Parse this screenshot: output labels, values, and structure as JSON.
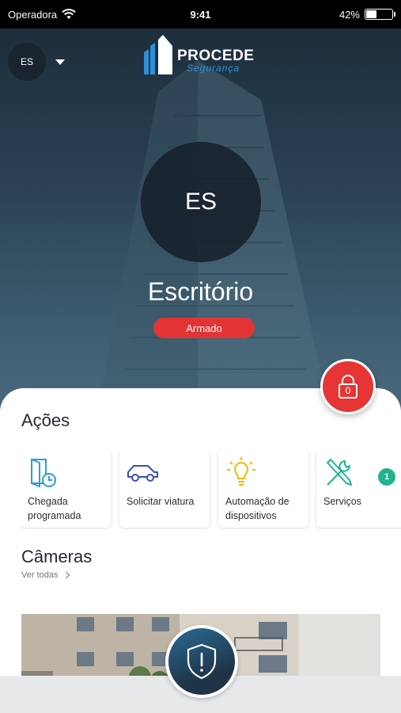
{
  "status_bar": {
    "carrier": "Operadora",
    "time": "9:41",
    "battery_percent": "42%",
    "battery_level": 0.42
  },
  "header": {
    "site_initials": "ES",
    "logo_title": "PROCEDE",
    "logo_subtitle": "Segurança"
  },
  "site": {
    "initials": "ES",
    "name": "Escritório",
    "status": "Armado"
  },
  "lock_button": {
    "count": "0"
  },
  "actions": {
    "title": "Ações",
    "items": [
      {
        "label": "Chegada programada",
        "icon": "door-clock-icon"
      },
      {
        "label": "Solicitar viatura",
        "icon": "car-icon"
      },
      {
        "label": "Automação de dispositivos",
        "icon": "lightbulb-icon"
      },
      {
        "label": "Serviços",
        "icon": "tools-icon"
      }
    ],
    "badge": "1"
  },
  "cameras": {
    "title": "Câmeras",
    "see_all": "Ver todas"
  },
  "colors": {
    "accent_red": "#e63535",
    "accent_blue": "#2e8fd8",
    "badge_green": "#21b38f"
  }
}
